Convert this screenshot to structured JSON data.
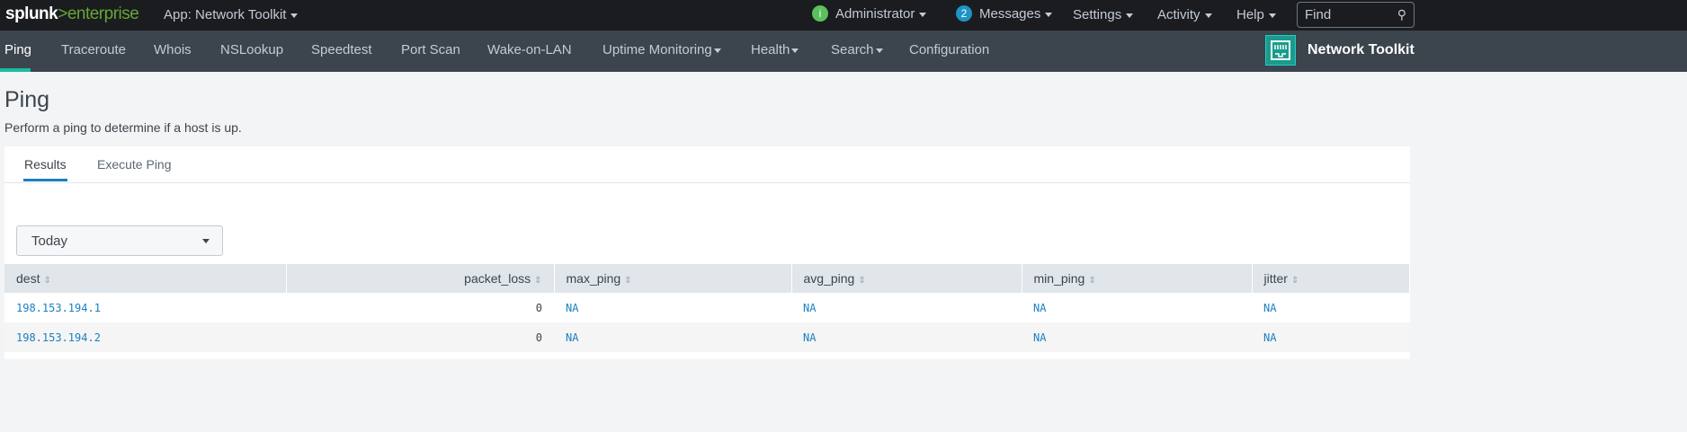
{
  "topbar": {
    "logo_main": "splunk",
    "logo_accent": ">enterprise",
    "app_label": "App: Network Toolkit",
    "user": "Administrator",
    "messages_count": "2",
    "messages": "Messages",
    "settings": "Settings",
    "activity": "Activity",
    "help": "Help",
    "find_placeholder": "Find"
  },
  "nav": {
    "items": [
      "Ping",
      "Traceroute",
      "Whois",
      "NSLookup",
      "Speedtest",
      "Port Scan",
      "Wake-on-LAN",
      "Uptime Monitoring",
      "Health",
      "Search",
      "Configuration"
    ],
    "app_title": "Network Toolkit"
  },
  "page": {
    "title": "Ping",
    "description": "Perform a ping to determine if a host is up."
  },
  "tabs": [
    "Results",
    "Execute Ping"
  ],
  "time_picker": {
    "value": "Today"
  },
  "table": {
    "columns": [
      "dest",
      "packet_loss",
      "max_ping",
      "avg_ping",
      "min_ping",
      "jitter"
    ],
    "rows": [
      [
        "198.153.194.1",
        "0",
        "NA",
        "NA",
        "NA",
        "NA"
      ],
      [
        "198.153.194.2",
        "0",
        "NA",
        "NA",
        "NA",
        "NA"
      ]
    ]
  },
  "colors": {
    "accent": "#1a7fc1",
    "nav_active": "#1abc9c",
    "logo_green": "#65a637"
  }
}
